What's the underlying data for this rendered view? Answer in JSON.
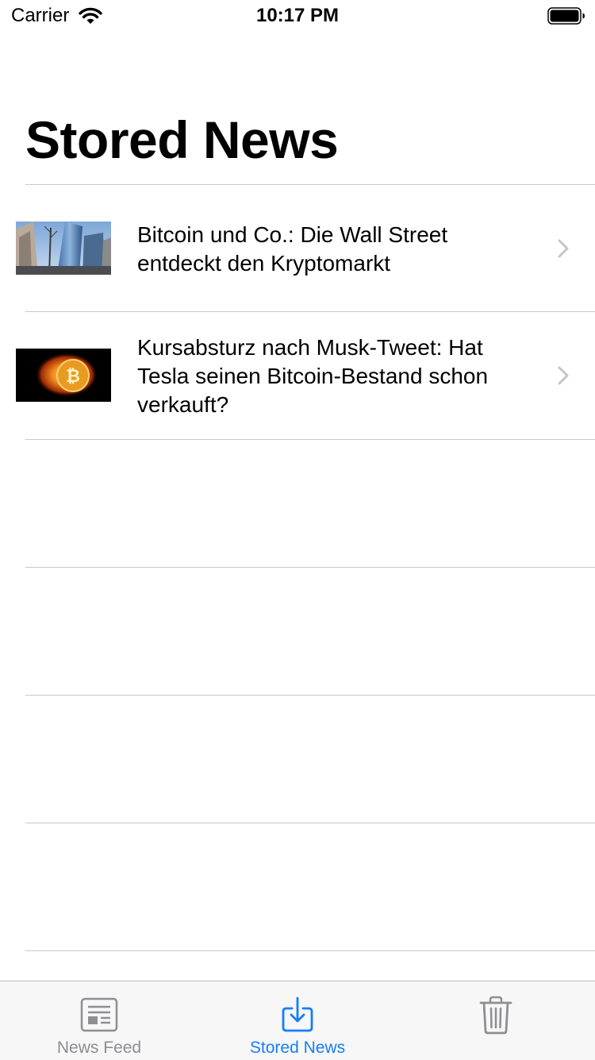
{
  "status_bar": {
    "carrier": "Carrier",
    "time": "10:17 PM"
  },
  "page": {
    "title": "Stored News"
  },
  "articles": [
    {
      "title": "Bitcoin und Co.: Die Wall Street entdeckt den Kryptomarkt",
      "thumbnail": "skyscraper-photo"
    },
    {
      "title": "Kursabsturz nach Musk-Tweet: Hat Tesla seinen Bitcoin-Bestand schon verkauft?",
      "thumbnail": "burning-bitcoin-photo"
    }
  ],
  "tab_bar": {
    "tabs": [
      {
        "label": "News Feed",
        "icon": "newspaper-icon",
        "selected": false
      },
      {
        "label": "Stored News",
        "icon": "download-tray-icon",
        "selected": true
      },
      {
        "label": "",
        "icon": "trash-icon",
        "selected": false
      }
    ]
  },
  "colors": {
    "accent": "#147EFB",
    "tab_inactive": "#8e8e93",
    "separator": "#c8c7cc",
    "chevron": "#c4c4c7"
  }
}
